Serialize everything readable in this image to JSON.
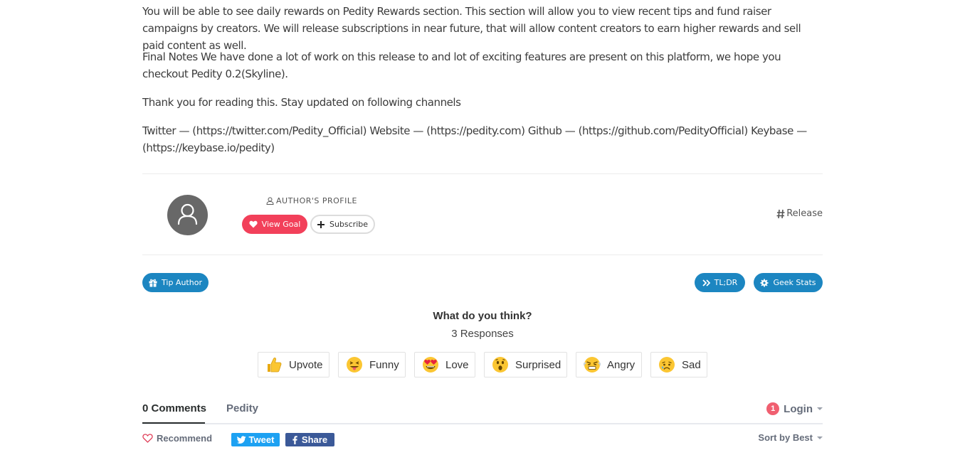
{
  "article": {
    "paragraphs": [
      "You will be able to see daily rewards on Pedity Rewards section. This section will allow you to view recent tips and fund raiser campaigns by creators. We will release subscriptions in near future, that will allow content creators to earn higher rewards and sell paid content as well.",
      "Final Notes We have done a lot of work on this release to and lot of exciting features are present on this platform, we hope you checkout Pedity 0.2(Skyline).",
      "Thank you for reading this. Stay updated on following channels",
      "Twitter — (https://twitter.com/Pedity_Official) Website — (https://pedity.com) Github — (https://github.com/PedityOfficial) Keybase — (https://keybase.io/pedity)"
    ]
  },
  "author": {
    "profile_label": "AUTHOR'S PROFILE",
    "view_goal_label": "View Goal",
    "subscribe_label": "Subscribe",
    "tag": "Release"
  },
  "actions": {
    "tip_label": "Tip Author",
    "tldr_label": "TL;DR",
    "geek_label": "Geek Stats"
  },
  "reactions": {
    "title": "What do you think?",
    "responses": "3 Responses",
    "items": [
      {
        "label": "Upvote",
        "icon": "thumbs-up-icon"
      },
      {
        "label": "Funny",
        "icon": "tongue-face-icon"
      },
      {
        "label": "Love",
        "icon": "heart-eyes-icon"
      },
      {
        "label": "Surprised",
        "icon": "surprised-face-icon"
      },
      {
        "label": "Angry",
        "icon": "angry-face-icon"
      },
      {
        "label": "Sad",
        "icon": "sad-face-icon"
      }
    ]
  },
  "comments": {
    "tab_comments": "0 Comments",
    "tab_site": "Pedity",
    "notification_count": "1",
    "login_label": "Login",
    "recommend_label": "Recommend",
    "tweet_label": "Tweet",
    "share_label": "Share",
    "sort_label": "Sort by Best"
  },
  "colors": {
    "goal": "#f2405a",
    "pill": "#1c86c1",
    "twitter": "#1da1f2",
    "facebook": "#3b5998",
    "badge": "#f05f70"
  }
}
